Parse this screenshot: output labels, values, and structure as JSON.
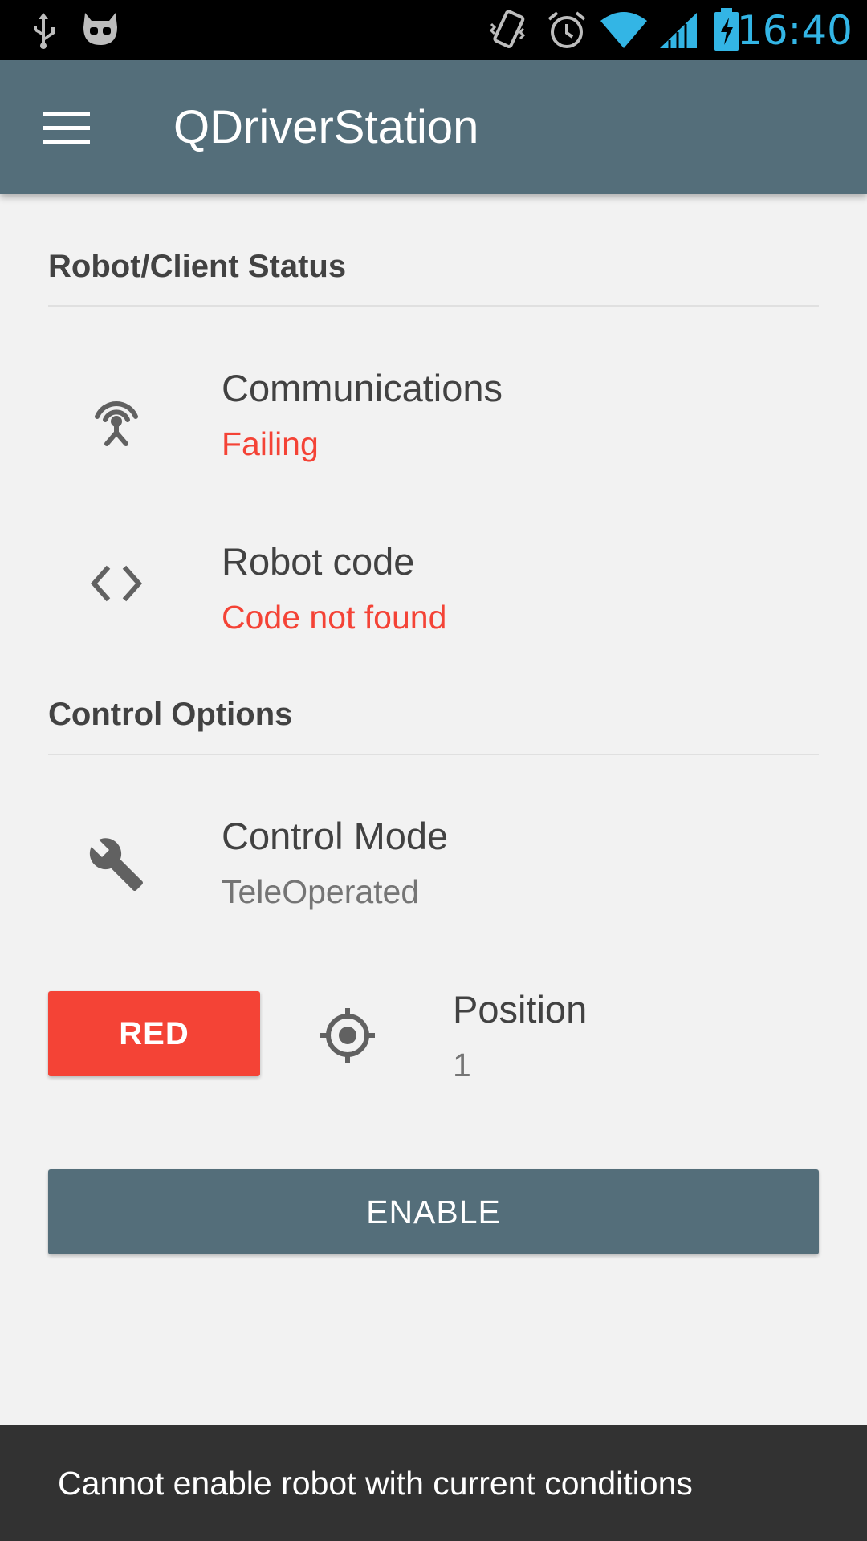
{
  "status_bar": {
    "time": "16:40",
    "icons": [
      "usb-icon",
      "cyanogenmod-icon",
      "vibrate-icon",
      "alarm-icon",
      "wifi-icon",
      "cell-signal-icon",
      "battery-charging-icon"
    ],
    "time_color": "#33b5e5"
  },
  "app_bar": {
    "title": "QDriverStation",
    "menu_icon": "menu-icon",
    "color": "#546e7a"
  },
  "status_section": {
    "header": "Robot/Client Status",
    "items": [
      {
        "icon": "antenna-icon",
        "title": "Communications",
        "value": "Failing",
        "value_color": "#f44336"
      },
      {
        "icon": "code-icon",
        "title": "Robot code",
        "value": "Code not found",
        "value_color": "#f44336"
      }
    ]
  },
  "control_section": {
    "header": "Control Options",
    "mode": {
      "icon": "wrench-icon",
      "title": "Control Mode",
      "value": "TeleOperated"
    },
    "alliance_button": {
      "label": "RED",
      "color": "#f44336"
    },
    "position": {
      "icon": "target-icon",
      "title": "Position",
      "value": "1"
    },
    "enable_button": {
      "label": "ENABLE"
    }
  },
  "snackbar": {
    "message": "Cannot enable robot with current conditions"
  }
}
